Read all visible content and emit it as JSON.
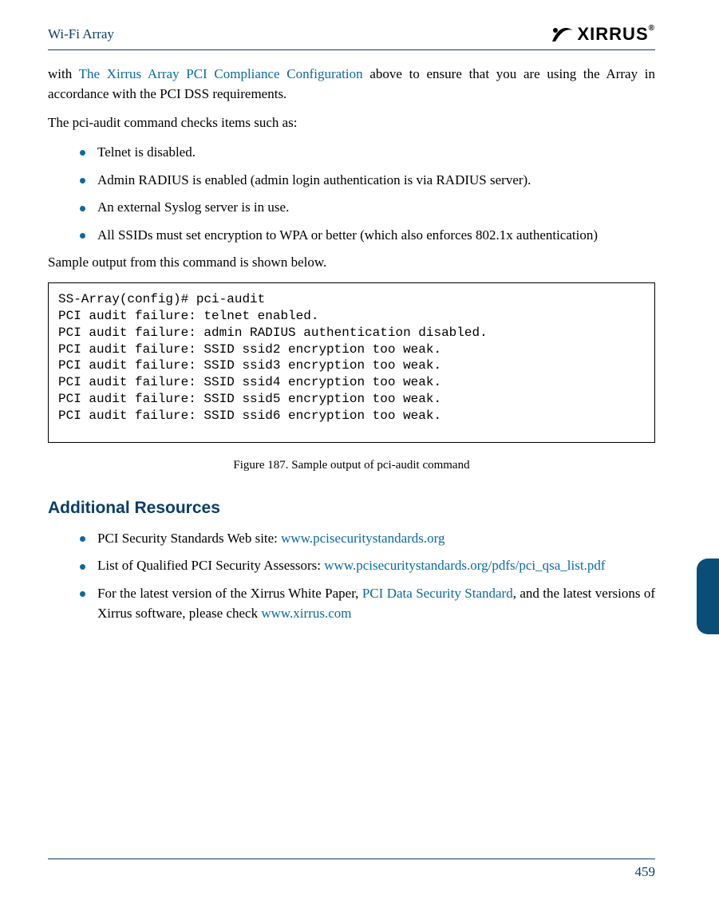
{
  "header": {
    "title": "Wi-Fi Array",
    "logo_text": "XIRRUS",
    "logo_reg": "®"
  },
  "body": {
    "intro_pre": "with ",
    "intro_link": "The Xirrus Array PCI Compliance Configuration",
    "intro_post": " above to ensure that you are using the Array in accordance with the PCI DSS requirements.",
    "para2": "The pci-audit command checks items such as:",
    "bullets1": [
      "Telnet is disabled.",
      "Admin RADIUS is enabled (admin login authentication is via RADIUS server).",
      "An external Syslog server is in use.",
      "All SSIDs must set encryption to WPA or better (which also enforces 802.1x authentication)"
    ],
    "para3": "Sample output from this command is shown below.",
    "code": "SS-Array(config)# pci-audit\nPCI audit failure: telnet enabled.\nPCI audit failure: admin RADIUS authentication disabled.\nPCI audit failure: SSID ssid2 encryption too weak.\nPCI audit failure: SSID ssid3 encryption too weak.\nPCI audit failure: SSID ssid4 encryption too weak.\nPCI audit failure: SSID ssid5 encryption too weak.\nPCI audit failure: SSID ssid6 encryption too weak.",
    "figure_caption": "Figure 187. Sample output of pci-audit command",
    "h2": "Additional Resources",
    "res": {
      "b1_pre": "PCI Security Standards Web site: ",
      "b1_link": "www.pcisecuritystandards.org",
      "b2_pre": "List of Qualified PCI Security Assessors: ",
      "b2_link": "www.pcisecuritystandards.org/pdfs/pci_qsa_list.pdf",
      "b3_pre": "For the latest version of the Xirrus White Paper, ",
      "b3_link1": "PCI Data Security Standard",
      "b3_mid": ", and the latest versions of Xirrus software, please check ",
      "b3_link2": "www.xirrus.com"
    }
  },
  "footer": {
    "page_number": "459"
  }
}
